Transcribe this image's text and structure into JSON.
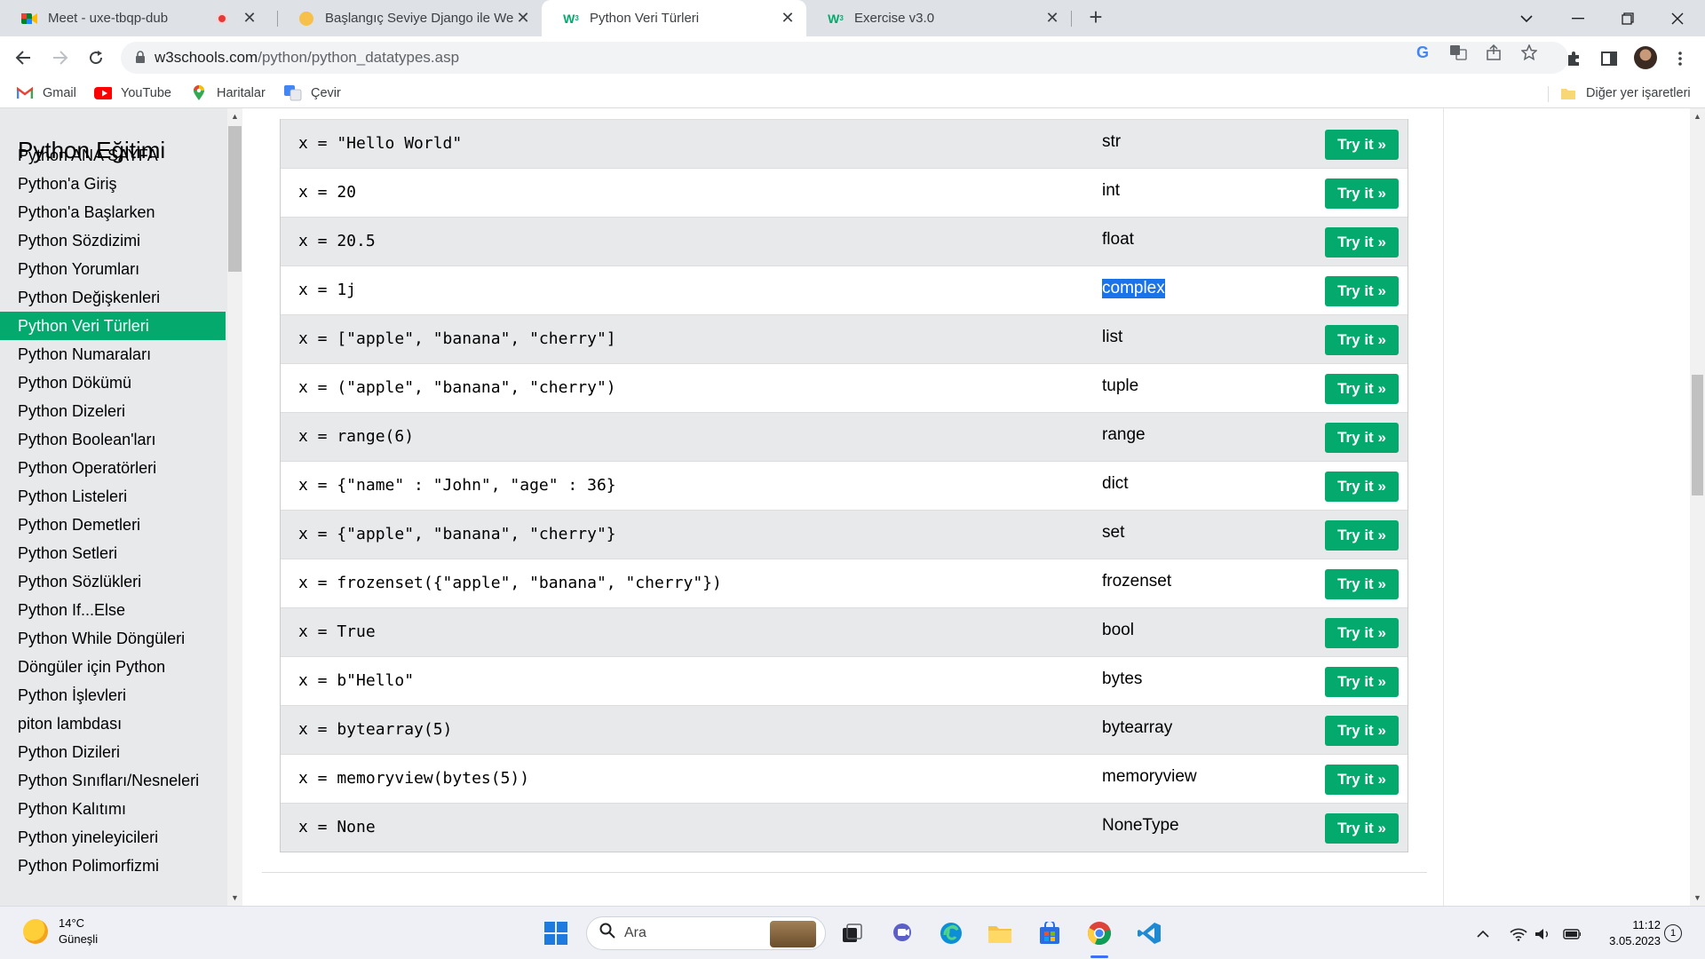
{
  "tabs": [
    {
      "title": "Meet - uxe-tbqp-dub",
      "icon": "google-meet-icon",
      "recording": true
    },
    {
      "title": "Başlangıç Seviye Django ile Web",
      "icon": "site-icon"
    },
    {
      "title": "Python Veri Türleri",
      "icon": "w3schools-icon",
      "active": true
    },
    {
      "title": "Exercise v3.0",
      "icon": "w3schools-icon"
    }
  ],
  "address": {
    "host": "w3schools.com",
    "path": "/python/python_datatypes.asp"
  },
  "bookmarks": [
    {
      "label": "Gmail",
      "icon": "gmail-icon"
    },
    {
      "label": "YouTube",
      "icon": "youtube-icon"
    },
    {
      "label": "Haritalar",
      "icon": "maps-icon"
    },
    {
      "label": "Çevir",
      "icon": "translate-icon"
    }
  ],
  "other_bookmarks": "Diğer yer işaretleri",
  "sidebar": {
    "title": "Python Eğitimi",
    "items": [
      "Python ANA SAYFA",
      "Python'a Giriş",
      "Python'a Başlarken",
      "Python Sözdizimi",
      "Python Yorumları",
      "Python Değişkenleri",
      "Python Veri Türleri",
      "Python Numaraları",
      "Python Dökümü",
      "Python Dizeleri",
      "Python Boolean'ları",
      "Python Operatörleri",
      "Python Listeleri",
      "Python Demetleri",
      "Python Setleri",
      "Python Sözlükleri",
      "Python If...Else",
      "Python While Döngüleri",
      "Döngüler için Python",
      "Python İşlevleri",
      "piton lambdası",
      "Python Dizileri",
      "Python Sınıfları/Nesneleri",
      "Python Kalıtımı",
      "Python yineleyicileri",
      "Python Polimorfizmi"
    ],
    "active_item": "Python Veri Türleri"
  },
  "table": {
    "rows": [
      {
        "code": "x = \"Hello World\"",
        "type": "str"
      },
      {
        "code": "x = 20",
        "type": "int"
      },
      {
        "code": "x = 20.5",
        "type": "float"
      },
      {
        "code": "x = 1j",
        "type": "complex",
        "selected": true
      },
      {
        "code": "x = [\"apple\", \"banana\", \"cherry\"]",
        "type": "list"
      },
      {
        "code": "x = (\"apple\", \"banana\", \"cherry\")",
        "type": "tuple"
      },
      {
        "code": "x = range(6)",
        "type": "range"
      },
      {
        "code": "x = {\"name\" : \"John\", \"age\" : 36}",
        "type": "dict"
      },
      {
        "code": "x = {\"apple\", \"banana\", \"cherry\"}",
        "type": "set"
      },
      {
        "code": "x = frozenset({\"apple\", \"banana\", \"cherry\"})",
        "type": "frozenset"
      },
      {
        "code": "x = True",
        "type": "bool"
      },
      {
        "code": "x = b\"Hello\"",
        "type": "bytes"
      },
      {
        "code": "x = bytearray(5)",
        "type": "bytearray"
      },
      {
        "code": "x = memoryview(bytes(5))",
        "type": "memoryview"
      },
      {
        "code": "x = None",
        "type": "NoneType"
      }
    ],
    "try_label": "Try it »"
  },
  "taskbar": {
    "weather_temp": "14°C",
    "weather_desc": "Güneşli",
    "search_placeholder": "Ara",
    "time": "11:12",
    "date": "3.05.2023",
    "notifications": "1"
  },
  "colors": {
    "accent": "#04aa6d",
    "selection": "#1a73e8"
  }
}
